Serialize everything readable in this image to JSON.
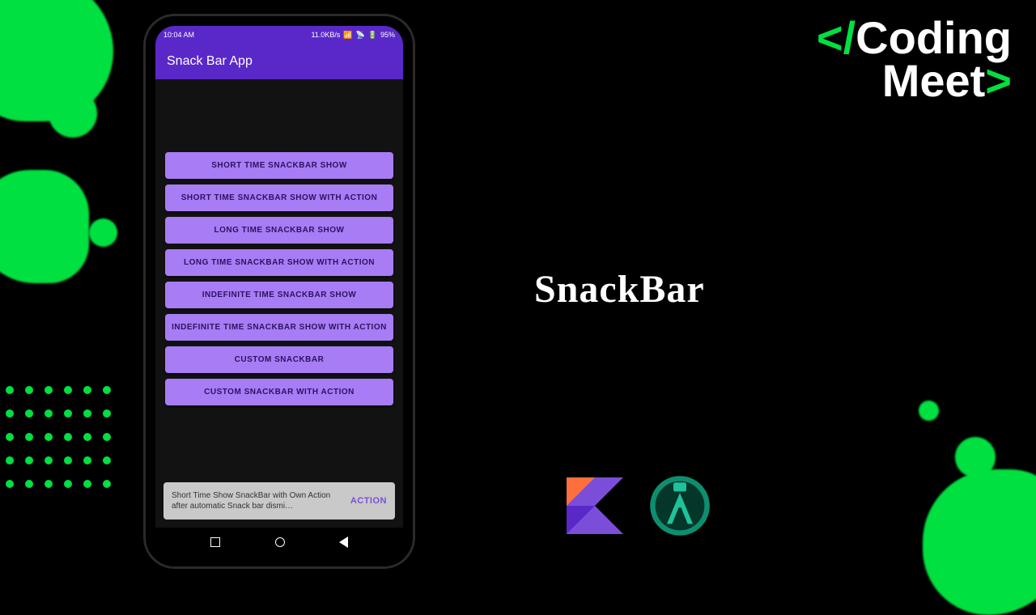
{
  "logo": {
    "line1": "Coding",
    "line2": "Meet"
  },
  "main_title": "SnackBar",
  "status": {
    "time": "10:04 AM",
    "speed": "11.0KB/s",
    "battery": "95%"
  },
  "app_bar": {
    "title": "Snack Bar App"
  },
  "buttons": [
    "SHORT TIME SNACKBAR SHOW",
    "SHORT TIME SNACKBAR SHOW WITH ACTION",
    "LONG TIME SNACKBAR SHOW",
    "LONG TIME SNACKBAR SHOW WITH ACTION",
    "INDEFINITE TIME SNACKBAR SHOW",
    "INDEFINITE TIME SNACKBAR SHOW WITH ACTION",
    "CUSTOM SNACKBAR",
    "CUSTOM SNACKBAR WITH ACTION"
  ],
  "snackbar": {
    "text": "Short Time Show SnackBar with Own Action after automatic Snack bar dismi…",
    "action": "ACTION"
  }
}
